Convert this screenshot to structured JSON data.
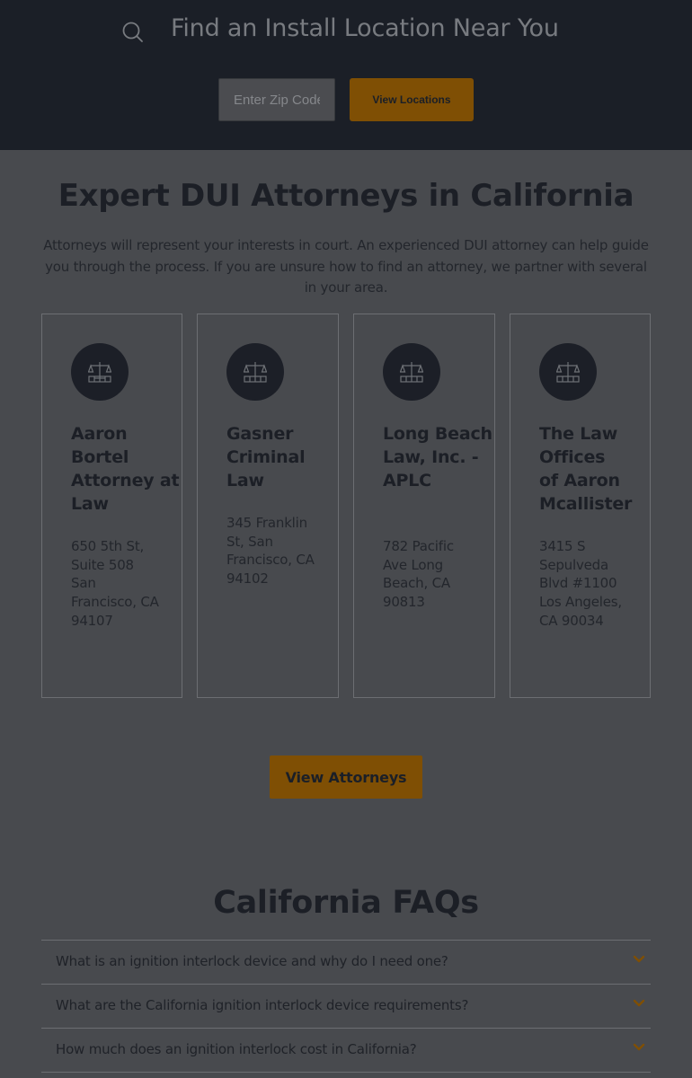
{
  "search": {
    "title": "Find an Install Location Near You",
    "zip_placeholder": "Enter Zip Code",
    "button_label": "View Locations",
    "icon": "search-icon"
  },
  "section": {
    "title": "Expert DUI Attorneys in California",
    "intro": "Attorneys will represent your interests in court. An experienced DUI attorney can help guide you through the process. If you are unsure how to find an attorney, we partner with several in your area."
  },
  "attorneys": [
    {
      "icon": "scales-icon",
      "name": "Aaron Bortel Attorney at Law",
      "address": "650 5th St, Suite 508 San Francisco, CA 94107"
    },
    {
      "icon": "scales-icon",
      "name": "Gasner Criminal Law",
      "address": "345 Franklin St, San Francisco, CA 94102"
    },
    {
      "icon": "scales-icon",
      "name": "Long Beach Law, Inc. - APLC",
      "address": "782 Pacific Ave Long Beach, CA 90813"
    },
    {
      "icon": "scales-icon",
      "name": "The Law Offices of Aaron Mcallister",
      "address": "3415 S Sepulveda Blvd #1100 Los Angeles, CA 90034"
    }
  ],
  "view_attorneys_label": "View Attorneys",
  "faq": {
    "title": "California FAQs",
    "items": [
      {
        "question": "What is an ignition interlock device and why do I need one?",
        "icon": "chevron-down-icon"
      },
      {
        "question": "What are the California ignition interlock device requirements?",
        "icon": "chevron-down-icon"
      },
      {
        "question": "How much does an ignition interlock cost in California?",
        "icon": "chevron-down-icon"
      }
    ]
  },
  "colors": {
    "header_bg": "#1b1f27",
    "page_bg": "#484a4e",
    "accent": "#7f4f04"
  }
}
